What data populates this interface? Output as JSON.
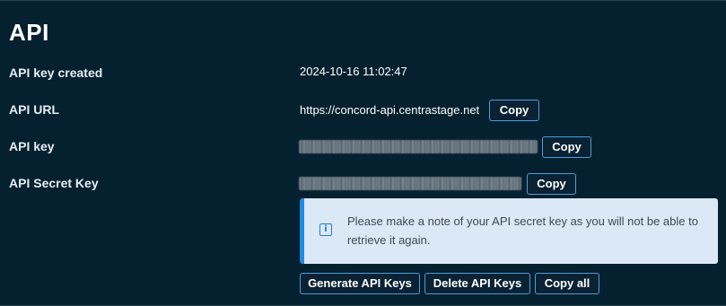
{
  "section": {
    "title": "API"
  },
  "rows": {
    "created": {
      "label": "API key created",
      "value": "2024-10-16 11:02:47"
    },
    "url": {
      "label": "API URL",
      "value": "https://concord-api.centrastage.net",
      "copy_label": "Copy"
    },
    "key": {
      "label": "API key",
      "copy_label": "Copy"
    },
    "secret": {
      "label": "API Secret Key",
      "copy_label": "Copy"
    }
  },
  "notice": {
    "icon": "info-icon",
    "text": "Please make a note of your API secret key as you will not be able to retrieve it again."
  },
  "actions": {
    "generate_label": "Generate API Keys",
    "delete_label": "Delete API Keys",
    "copy_all_label": "Copy all"
  },
  "colors": {
    "background": "#05202f",
    "button_border": "#4a9ed8",
    "notice_background": "#dbe9f6",
    "notice_accent": "#1f8be0"
  }
}
